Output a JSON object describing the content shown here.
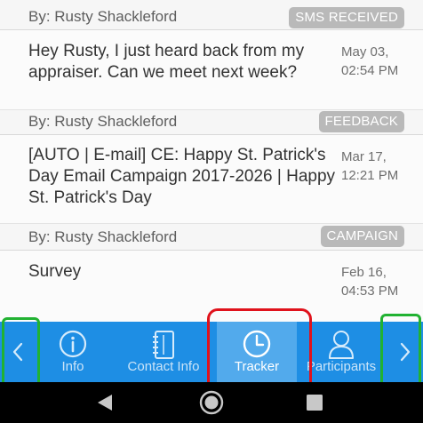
{
  "messages": [
    {
      "by": "By: Rusty Shackleford",
      "tag": "SMS RECEIVED",
      "text": "Hey Rusty, I just heard back from my appraiser. Can we meet next week?",
      "date_line1": "May 03,",
      "date_line2": "02:54 PM"
    },
    {
      "by": "By: Rusty Shackleford",
      "tag": "FEEDBACK",
      "text": "[AUTO | E-mail] CE: Happy St. Patrick's Day Email Campaign 2017-2026 | Happy St. Patrick's Day",
      "date_line1": "Mar 17,",
      "date_line2": "12:21 PM"
    },
    {
      "by": "By: Rusty Shackleford",
      "tag": "CAMPAIGN",
      "text": "Survey",
      "date_line1": "Feb 16,",
      "date_line2": "04:53 PM"
    }
  ],
  "nav": {
    "tabs": [
      {
        "label": "Info",
        "icon": "info-icon"
      },
      {
        "label": "Contact Info",
        "icon": "address-book-icon"
      },
      {
        "label": "Tracker",
        "icon": "clock-icon",
        "active": true
      },
      {
        "label": "Participants",
        "icon": "person-icon"
      }
    ],
    "prev_icon": "chevron-left-icon",
    "next_icon": "chevron-right-icon"
  },
  "system_bar": {
    "back_icon": "back-triangle-icon",
    "home_icon": "home-circle-icon",
    "recents_icon": "recents-square-icon"
  },
  "colors": {
    "nav_bg": "#1e8ee4",
    "nav_active": "#52aaec",
    "tag_bg": "#b9b9b9",
    "highlight_green": "#21b232",
    "highlight_red": "#e0121c"
  }
}
